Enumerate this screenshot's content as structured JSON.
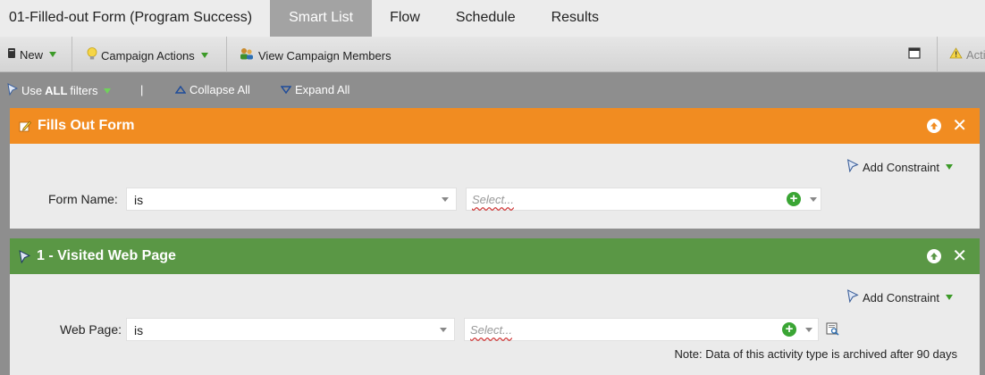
{
  "tabs": {
    "title": "01-Filled-out Form (Program Success)",
    "items": [
      "Smart List",
      "Flow",
      "Schedule",
      "Results"
    ]
  },
  "toolbar": {
    "new_label": "New",
    "campaign_actions_label": "Campaign Actions",
    "view_members_label": "View Campaign Members",
    "activity_label": "Acti"
  },
  "filterbar": {
    "use_prefix": "Use",
    "use_bold": "ALL",
    "use_suffix": "filters",
    "separator": "|",
    "collapse_label": "Collapse All",
    "expand_label": "Expand All"
  },
  "filters": [
    {
      "title": "Fills Out Form",
      "add_constraint": "Add Constraint",
      "field_label": "Form Name:",
      "operator": "is",
      "value_placeholder": "Select...",
      "color": "#f18c21"
    },
    {
      "title": "1 - Visited Web Page",
      "add_constraint": "Add Constraint",
      "field_label": "Web Page:",
      "operator": "is",
      "value_placeholder": "Select...",
      "note": "Note: Data of this activity type is archived after 90 days",
      "color": "#5a9745"
    }
  ]
}
